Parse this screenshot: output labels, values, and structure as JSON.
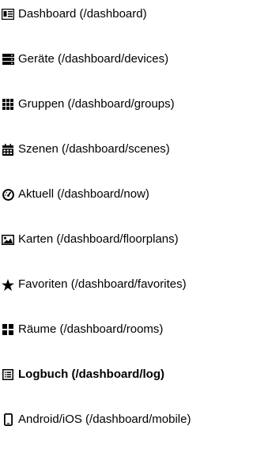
{
  "nav": {
    "items": [
      {
        "label": "Dashboard (/dashboard)",
        "icon": "dashboard-icon"
      },
      {
        "label": "Geräte (/dashboard/devices)",
        "icon": "server-icon"
      },
      {
        "label": "Gruppen (/dashboard/groups)",
        "icon": "grid-icon"
      },
      {
        "label": "Szenen (/dashboard/scenes)",
        "icon": "calendar-icon"
      },
      {
        "label": "Aktuell (/dashboard/now)",
        "icon": "gauge-icon"
      },
      {
        "label": "Karten (/dashboard/floorplans)",
        "icon": "image-icon"
      },
      {
        "label": "Favoriten (/dashboard/favorites)",
        "icon": "star-icon"
      },
      {
        "label": "Räume (/dashboard/rooms)",
        "icon": "squares-icon"
      },
      {
        "label": "Logbuch (/dashboard/log)",
        "icon": "list-icon",
        "active": true
      },
      {
        "label": "Android/iOS (/dashboard/mobile)",
        "icon": "mobile-icon"
      }
    ]
  }
}
